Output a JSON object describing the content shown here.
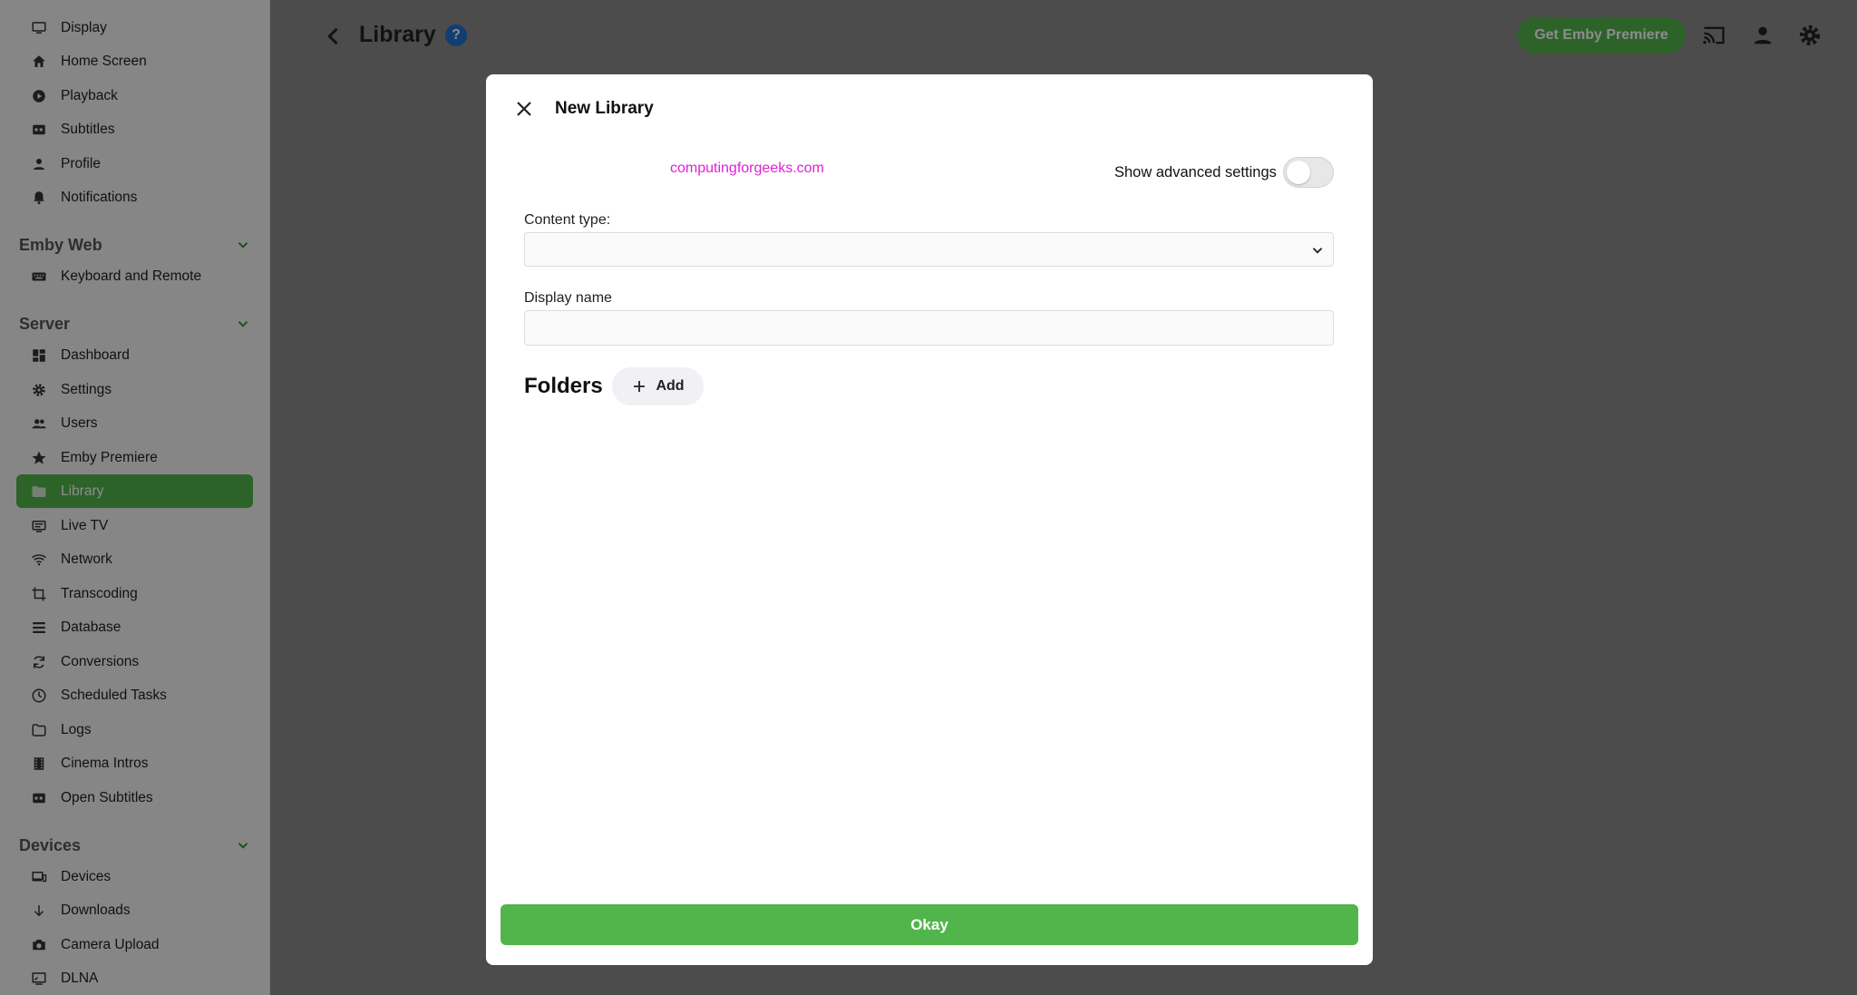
{
  "colors": {
    "accent": "#52b54b",
    "help_blue": "#1e6fcf",
    "watermark": "#e020d6"
  },
  "sidebar": {
    "items_top": [
      {
        "label": "Display",
        "icon": "monitor-icon"
      },
      {
        "label": "Home Screen",
        "icon": "home-icon"
      },
      {
        "label": "Playback",
        "icon": "play-circle-icon"
      },
      {
        "label": "Subtitles",
        "icon": "closed-caption-icon"
      },
      {
        "label": "Profile",
        "icon": "person-icon"
      },
      {
        "label": "Notifications",
        "icon": "bell-icon"
      }
    ],
    "emby_web": {
      "title": "Emby Web",
      "items": [
        {
          "label": "Keyboard and Remote",
          "icon": "keyboard-icon"
        }
      ]
    },
    "server": {
      "title": "Server",
      "items": [
        {
          "label": "Dashboard",
          "icon": "dashboard-icon"
        },
        {
          "label": "Settings",
          "icon": "gear-icon"
        },
        {
          "label": "Users",
          "icon": "users-icon"
        },
        {
          "label": "Emby Premiere",
          "icon": "star-icon"
        },
        {
          "label": "Library",
          "icon": "folder-icon",
          "active": true
        },
        {
          "label": "Live TV",
          "icon": "tv-icon"
        },
        {
          "label": "Network",
          "icon": "wifi-icon"
        },
        {
          "label": "Transcoding",
          "icon": "crop-icon"
        },
        {
          "label": "Database",
          "icon": "list-icon"
        },
        {
          "label": "Conversions",
          "icon": "sync-icon"
        },
        {
          "label": "Scheduled Tasks",
          "icon": "clock-icon"
        },
        {
          "label": "Logs",
          "icon": "folder-outline-icon"
        },
        {
          "label": "Cinema Intros",
          "icon": "film-icon"
        },
        {
          "label": "Open Subtitles",
          "icon": "closed-caption-icon"
        }
      ]
    },
    "devices": {
      "title": "Devices",
      "items": [
        {
          "label": "Devices",
          "icon": "devices-icon"
        },
        {
          "label": "Downloads",
          "icon": "download-arrow-icon"
        },
        {
          "label": "Camera Upload",
          "icon": "camera-icon"
        },
        {
          "label": "DLNA",
          "icon": "cast-screen-icon"
        }
      ]
    }
  },
  "header": {
    "title": "Library",
    "help_label": "?",
    "premiere_label": "Get Emby Premiere"
  },
  "dialog": {
    "title": "New Library",
    "watermark": "computingforgeeks.com",
    "advanced_label": "Show advanced settings",
    "advanced_on": false,
    "content_type_label": "Content type:",
    "content_type_value": "",
    "display_name_label": "Display name",
    "display_name_value": "",
    "folders_title": "Folders",
    "add_label": "Add",
    "okay_label": "Okay"
  }
}
